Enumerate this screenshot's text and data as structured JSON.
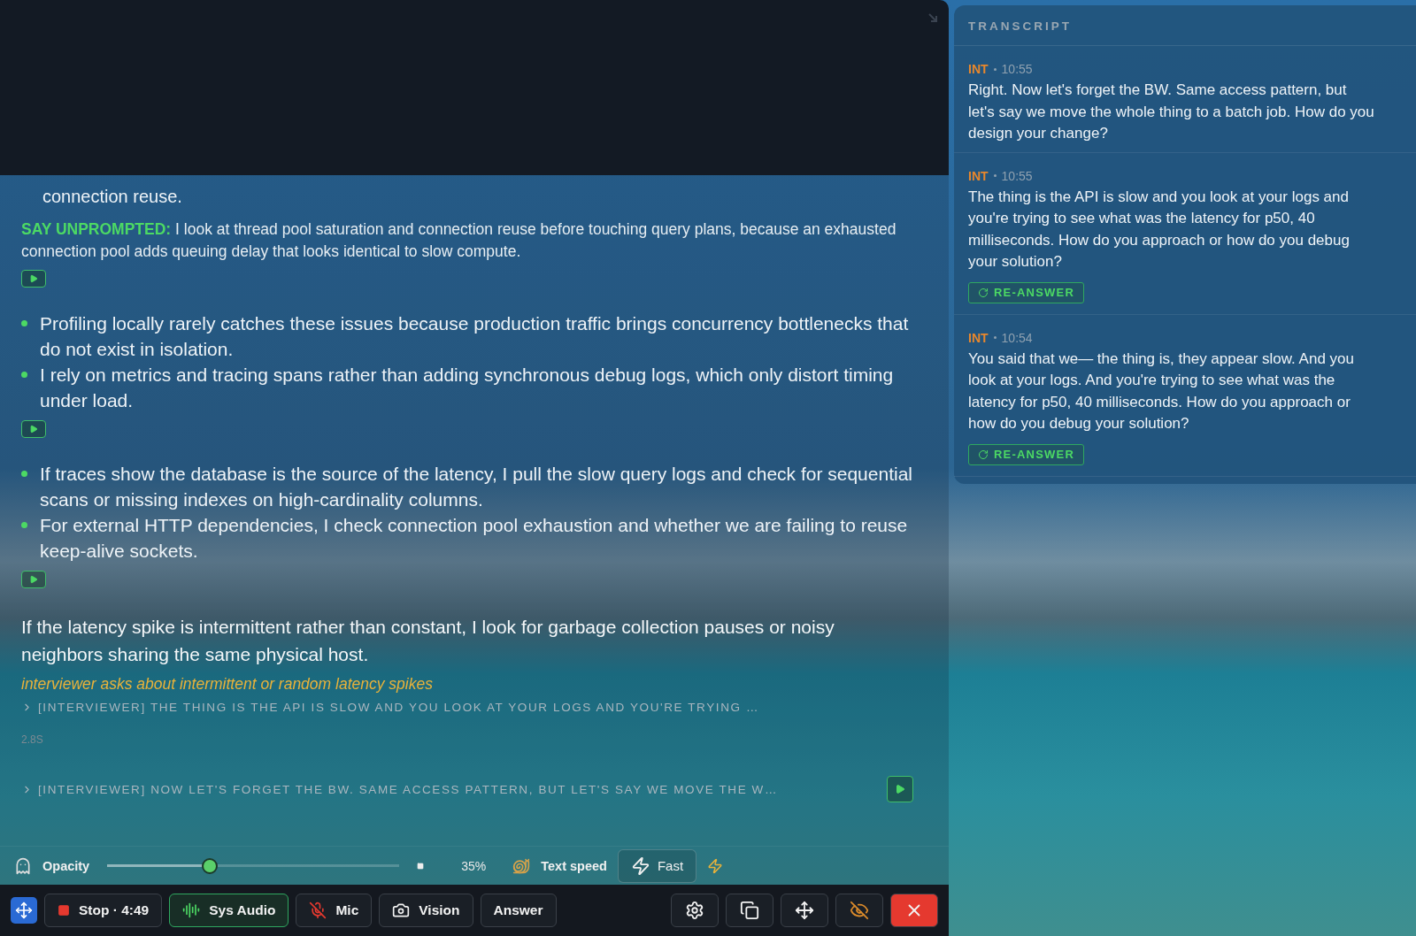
{
  "answer": {
    "continuation": "connection reuse.",
    "say_unprompted": "**SAY UNPROMPTED:** I look at thread pool saturation and connection reuse before touching query plans, because an exhausted connection pool adds queuing delay that looks identical to slow compute.",
    "bullet_groups": [
      [
        "Profiling locally rarely catches these issues because production traffic brings concurrency bottlenecks that do not exist in isolation.",
        "I rely on metrics and tracing spans rather than adding synchronous debug logs, which only distort timing under load."
      ],
      [
        "If traces show the database is the source of the latency, I pull the slow query logs and check for sequential scans or missing indexes on high-cardinality columns.",
        "For external HTTP dependencies, I check connection pool exhaustion and whether we are failing to reuse keep-alive sockets."
      ]
    ],
    "summary": "If the latency spike is intermittent rather than constant, I look for garbage collection pauses or noisy neighbors sharing the same physical host.",
    "cue": "interviewer asks about intermittent or random latency spikes",
    "interviewer_lines": [
      {
        "text": "[INTERVIEWER] THE THING IS THE API IS SLOW AND YOU LOOK AT YOUR LOGS AND YOU'RE TRYING …",
        "playable": false,
        "elapsed": "2.8S"
      },
      {
        "text": "[INTERVIEWER] NOW LET'S FORGET THE BW. SAME ACCESS PATTERN, BUT LET'S SAY WE MOVE THE W…",
        "playable": true
      }
    ]
  },
  "controls": {
    "opacity": {
      "label": "Opacity",
      "level": 0.35,
      "reading": "35%"
    },
    "text_speed": {
      "label": "Text speed",
      "value": "Fast"
    }
  },
  "toolbar": {
    "buttons": [
      {
        "kind": "stop",
        "label": "Stop · 4:49",
        "active": false
      },
      {
        "kind": "audio",
        "label": "Sys Audio",
        "active": true
      },
      {
        "kind": "mic",
        "label": "Mic",
        "active": false
      },
      {
        "kind": "vision",
        "label": "Vision",
        "active": false
      },
      {
        "kind": "plain",
        "label": "Answer",
        "active": false
      }
    ],
    "icon_buttons": [
      {
        "kind": "settings"
      },
      {
        "kind": "windows"
      },
      {
        "kind": "move"
      },
      {
        "kind": "hide"
      },
      {
        "kind": "close"
      }
    ]
  },
  "transcript": {
    "title": "TRANSCRIPT",
    "entries": [
      {
        "speaker": "INT",
        "time": "10:55",
        "text": "Right. Now let's forget the BW. Same access pattern, but let's say we move the whole thing to a batch job. How do you design your change?"
      },
      {
        "speaker": "INT",
        "time": "10:55",
        "text": "The thing is the API is slow and you look at your logs and you're trying to see what was the latency for p50, 40 milliseconds. How do you approach or how do you debug your solution?",
        "action": "RE-ANSWER"
      },
      {
        "speaker": "INT",
        "time": "10:54",
        "text": "You said that we— the thing is, they appear slow. And you look at your logs. And you're trying to see what was the latency for p50, 40 milliseconds. How do you approach or how do you debug your solution?",
        "action": "RE-ANSWER"
      }
    ]
  }
}
